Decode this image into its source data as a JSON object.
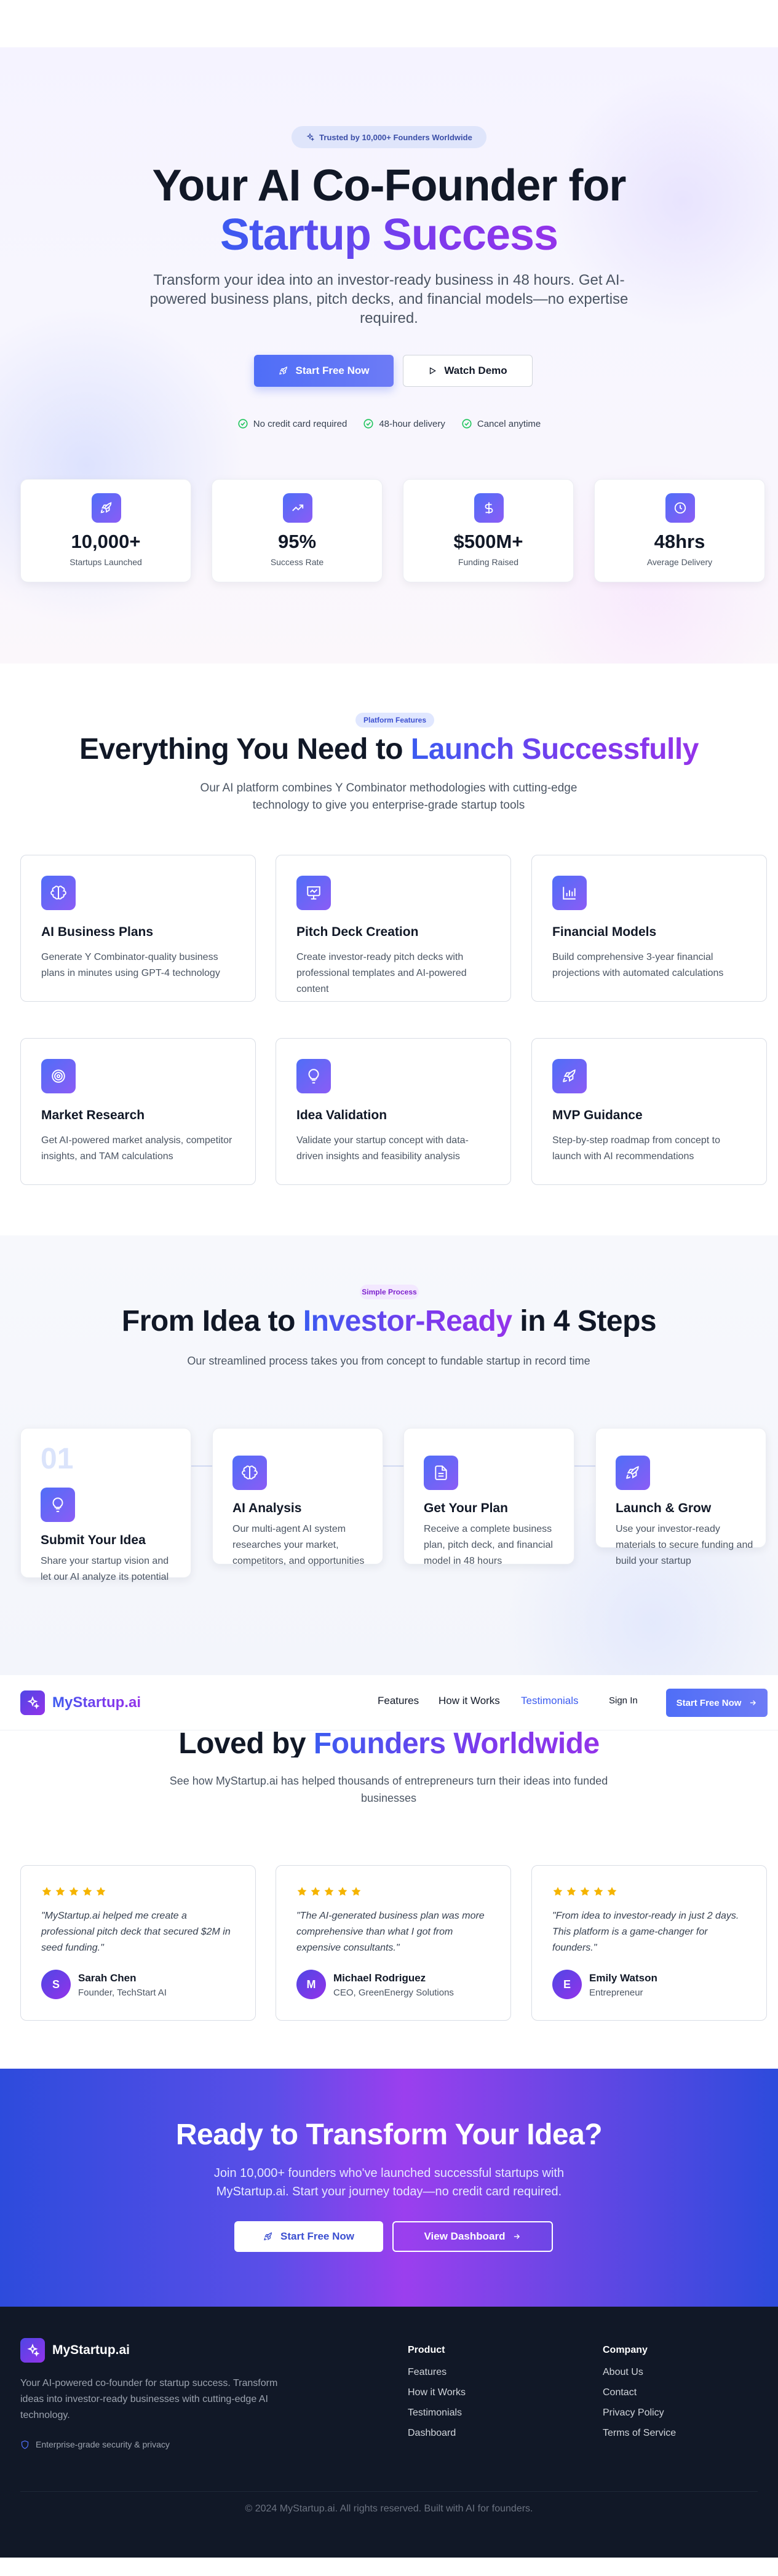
{
  "hero": {
    "badge": "Trusted by 10,000+ Founders Worldwide",
    "title_line1": "Your AI Co-Founder for",
    "title_line2": "Startup Success",
    "subtitle": "Transform your idea into an investor-ready business in 48 hours. Get AI-powered business plans, pitch decks, and financial models—no expertise required.",
    "cta_primary": "Start Free Now",
    "cta_secondary": "Watch Demo",
    "checks": [
      "No credit card required",
      "48-hour delivery",
      "Cancel anytime"
    ],
    "stats": [
      {
        "value": "10,000+",
        "label": "Startups Launched",
        "icon": "rocket-icon"
      },
      {
        "value": "95%",
        "label": "Success Rate",
        "icon": "trending-up-icon"
      },
      {
        "value": "$500M+",
        "label": "Funding Raised",
        "icon": "dollar-icon"
      },
      {
        "value": "48hrs",
        "label": "Average Delivery",
        "icon": "clock-icon"
      }
    ]
  },
  "features": {
    "pill": "Platform Features",
    "title_plain": "Everything You Need to",
    "title_grad": "Launch Successfully",
    "subtitle": "Our AI platform combines Y Combinator methodologies with cutting-edge technology to give you enterprise-grade startup tools",
    "items": [
      {
        "title": "AI Business Plans",
        "desc": "Generate Y Combinator-quality business plans in minutes using GPT-4 technology",
        "icon": "brain-icon"
      },
      {
        "title": "Pitch Deck Creation",
        "desc": "Create investor-ready pitch decks with professional templates and AI-powered content",
        "icon": "presentation-icon"
      },
      {
        "title": "Financial Models",
        "desc": "Build comprehensive 3-year financial projections with automated calculations",
        "icon": "bar-chart-icon"
      },
      {
        "title": "Market Research",
        "desc": "Get AI-powered market analysis, competitor insights, and TAM calculations",
        "icon": "target-icon"
      },
      {
        "title": "Idea Validation",
        "desc": "Validate your startup concept with data-driven insights and feasibility analysis",
        "icon": "lightbulb-icon"
      },
      {
        "title": "MVP Guidance",
        "desc": "Step-by-step roadmap from concept to launch with AI recommendations",
        "icon": "rocket-icon"
      }
    ]
  },
  "process": {
    "pill": "Simple Process",
    "title_plain1": "From Idea to",
    "title_grad": "Investor-Ready",
    "title_plain2": "in 4 Steps",
    "subtitle": "Our streamlined process takes you from concept to fundable startup in record time",
    "step_number": "01",
    "steps": [
      {
        "title": "Submit Your Idea",
        "desc": "Share your startup vision and let our AI analyze its potential",
        "icon": "lightbulb-icon"
      },
      {
        "title": "AI Analysis",
        "desc": "Our multi-agent AI system researches your market, competitors, and opportunities",
        "icon": "brain-icon"
      },
      {
        "title": "Get Your Plan",
        "desc": "Receive a complete business plan, pitch deck, and financial model in 48 hours",
        "icon": "document-icon"
      },
      {
        "title": "Launch & Grow",
        "desc": "Use your investor-ready materials to secure funding and build your startup",
        "icon": "rocket-icon"
      }
    ]
  },
  "nav": {
    "brand": "MyStartup.ai",
    "links": [
      "Features",
      "How it Works",
      "Testimonials"
    ],
    "signin": "Sign In",
    "cta": "Start Free Now"
  },
  "testimonials": {
    "title_plain": "Loved by",
    "title_grad": "Founders Worldwide",
    "subtitle": "See how MyStartup.ai has helped thousands of entrepreneurs turn their ideas into funded businesses",
    "items": [
      {
        "quote": "\"MyStartup.ai helped me create a professional pitch deck that secured $2M in seed funding.\"",
        "initial": "S",
        "name": "Sarah Chen",
        "role": "Founder, TechStart AI"
      },
      {
        "quote": "\"The AI-generated business plan was more comprehensive than what I got from expensive consultants.\"",
        "initial": "M",
        "name": "Michael Rodriguez",
        "role": "CEO, GreenEnergy Solutions"
      },
      {
        "quote": "\"From idea to investor-ready in just 2 days. This platform is a game-changer for founders.\"",
        "initial": "E",
        "name": "Emily Watson",
        "role": "Entrepreneur"
      }
    ]
  },
  "cta": {
    "title": "Ready to Transform Your Idea?",
    "subtitle": "Join 10,000+ founders who've launched successful startups with MyStartup.ai. Start your journey today—no credit card required.",
    "primary": "Start Free Now",
    "secondary": "View Dashboard"
  },
  "footer": {
    "brand": "MyStartup.ai",
    "desc": "Your AI-powered co-founder for startup success. Transform ideas into investor-ready businesses with cutting-edge AI technology.",
    "security": "Enterprise-grade security & privacy",
    "product_heading": "Product",
    "product_links": [
      "Features",
      "How it Works",
      "Testimonials",
      "Dashboard"
    ],
    "company_heading": "Company",
    "company_links": [
      "About Us",
      "Contact",
      "Privacy Policy",
      "Terms of Service"
    ],
    "copyright": "© 2024 MyStartup.ai. All rights reserved. Built with AI for founders."
  },
  "colors": {
    "accent": "#4f6ef7",
    "accent_purple": "#8b5cf6",
    "footer_bg": "#111827",
    "check_green": "#22c55e",
    "star": "#f5b400"
  }
}
